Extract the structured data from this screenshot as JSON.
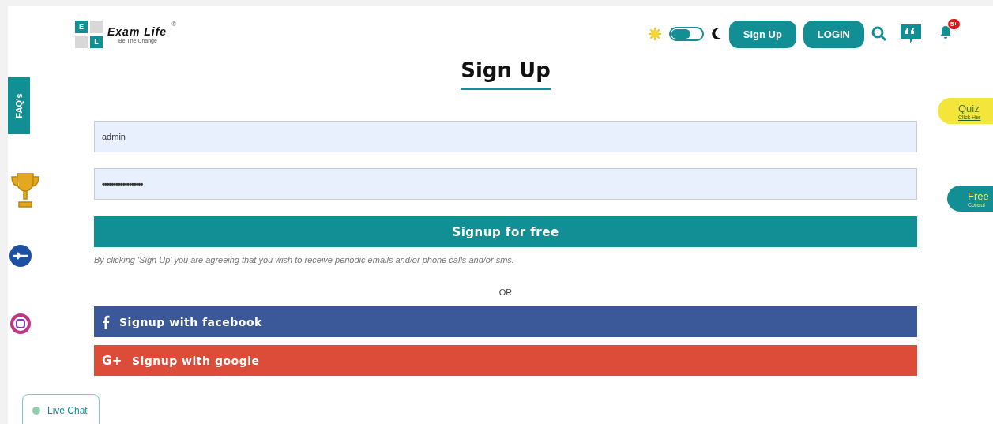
{
  "logo": {
    "letters": [
      "E",
      "L"
    ],
    "name": "Exam Life",
    "tagline": "Be The Change",
    "mark": "®"
  },
  "header": {
    "dark_mode": false,
    "buttons": [
      "Sign Up",
      "LOGIN"
    ],
    "notification_count": "5+"
  },
  "side_tabs": {
    "faq": "FAQ's",
    "quiz": {
      "title": "Quiz",
      "link": "Click Her"
    },
    "consult": {
      "title": "Free",
      "link": "Consul"
    }
  },
  "form": {
    "title": "Sign Up",
    "fields": [
      {
        "kind": "text",
        "value": "admin"
      },
      {
        "kind": "password",
        "value": "••••••••••••••••••"
      }
    ],
    "submit": "Signup for free",
    "notice": "By clicking 'Sign Up' you are agreeing that you wish to receive periodic emails and/or phone calls and/or sms.",
    "divider": "OR",
    "social": [
      {
        "kind": "facebook",
        "label": "Signup with facebook"
      },
      {
        "kind": "google",
        "label": "Signup with google",
        "icon_text": "G+"
      }
    ]
  },
  "live_chat": {
    "label": "Live Chat",
    "online": true
  }
}
